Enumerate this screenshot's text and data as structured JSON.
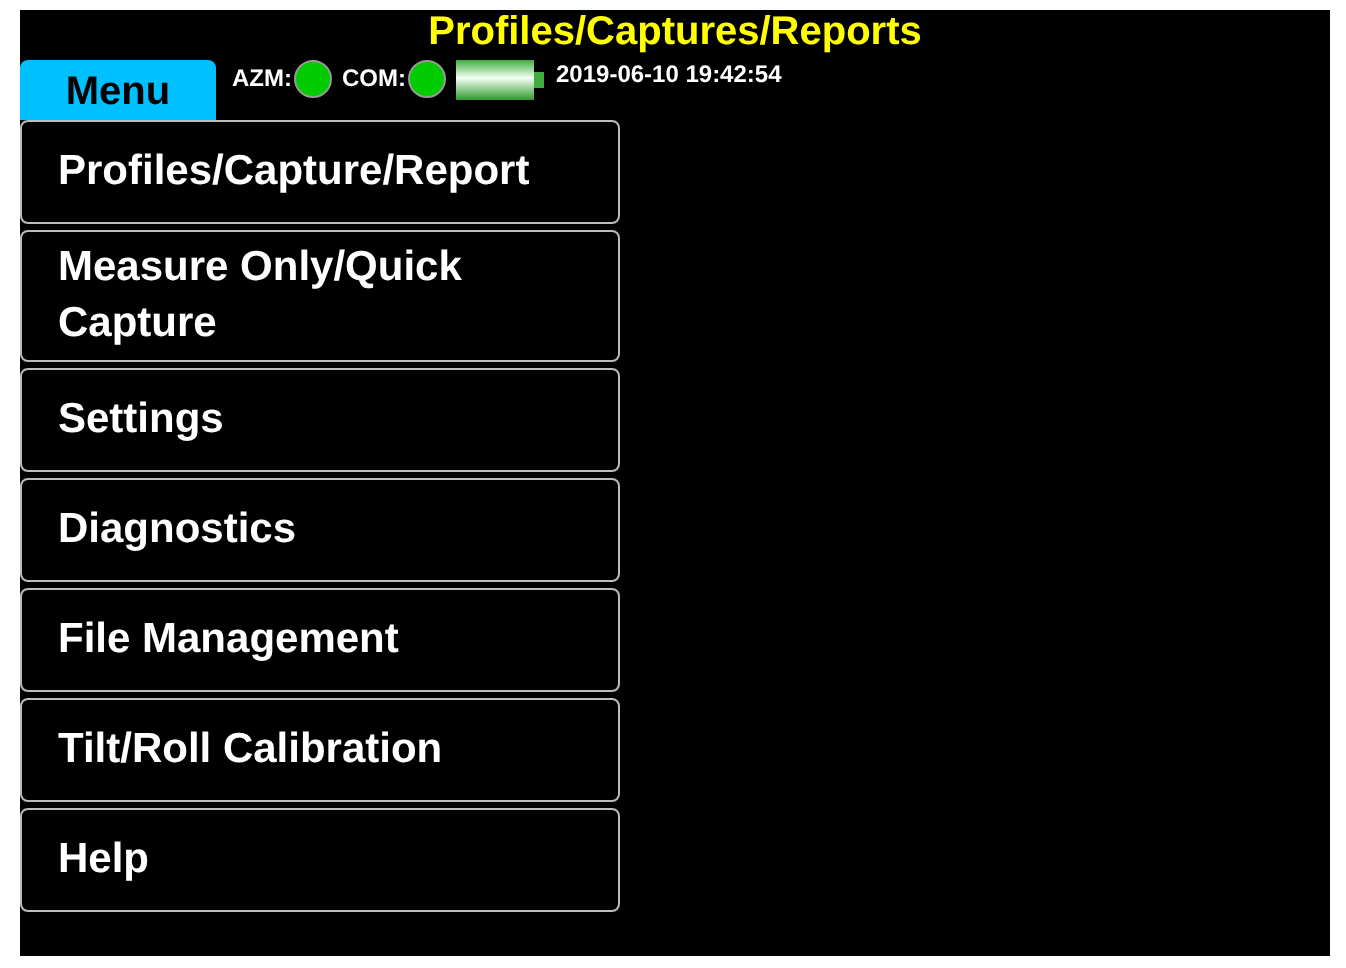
{
  "title": "Profiles/Captures/Reports",
  "menu_button": {
    "label": "Menu"
  },
  "status_bar": {
    "indicators": [
      {
        "label": "AZM:",
        "color": "#00cc00"
      },
      {
        "label": "COM:",
        "color": "#00cc00"
      }
    ],
    "datetime": "2019-06-10 19:42:54"
  },
  "menu": {
    "items": [
      {
        "label": "Profiles/Capture/Report"
      },
      {
        "label": "Measure Only/Quick Capture"
      },
      {
        "label": "Settings"
      },
      {
        "label": "Diagnostics"
      },
      {
        "label": "File Management"
      },
      {
        "label": "Tilt/Roll Calibration"
      },
      {
        "label": "Help"
      }
    ]
  }
}
